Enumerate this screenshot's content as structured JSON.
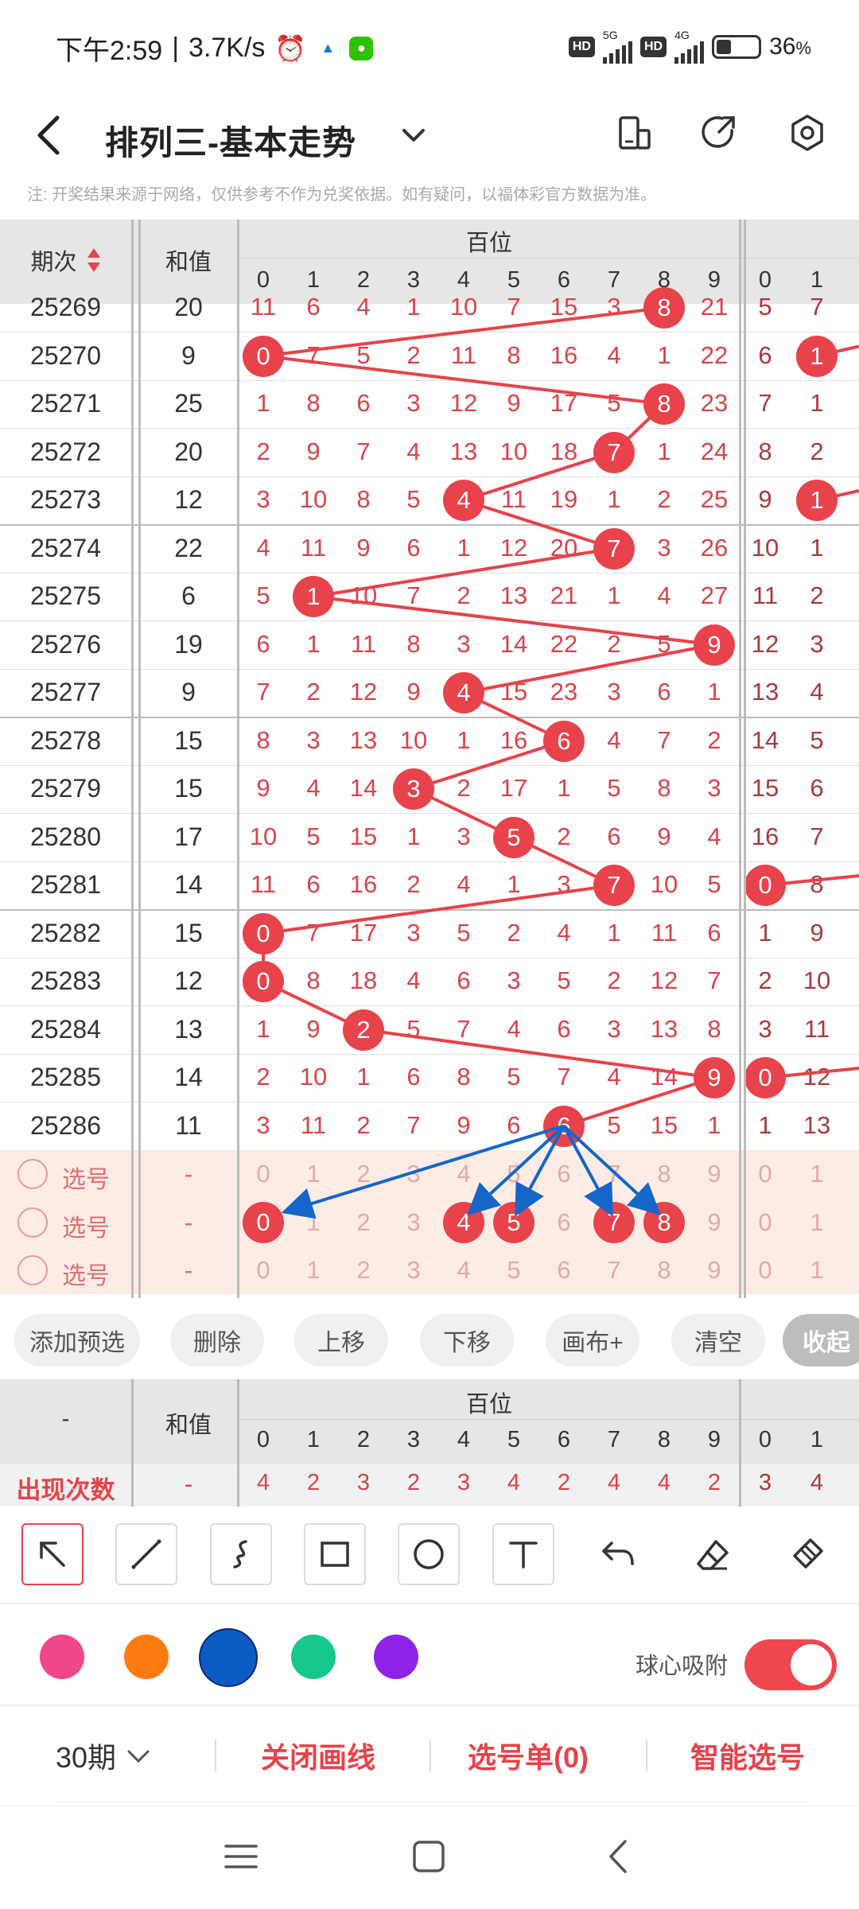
{
  "status_bar": {
    "time": "下午2:59",
    "speed": "3.7K/s",
    "hd1": "HD",
    "net1": "5G",
    "hd2": "HD",
    "net2": "4G",
    "battery": "36",
    "battery_unit": "%",
    "battery_level": 0.36
  },
  "header": {
    "title": "排列三-基本走势"
  },
  "note": "注: 开奖结果来源于网络，仅供参考不作为兑奖依据。如有疑问，以福体彩官方数据为准。",
  "table": {
    "col_issue": "期次",
    "col_sum": "和值",
    "group_hundreds": "百位",
    "digits": [
      "0",
      "1",
      "2",
      "3",
      "4",
      "5",
      "6",
      "7",
      "8",
      "9"
    ],
    "digits_next": [
      "0",
      "1"
    ],
    "rows": [
      {
        "issue": "25269",
        "sum": "20",
        "cells": [
          "11",
          "6",
          "4",
          "1",
          "10",
          "7",
          "15",
          "3",
          "8",
          "21"
        ],
        "next": [
          "5",
          "7"
        ],
        "hit": 8
      },
      {
        "issue": "25270",
        "sum": "9",
        "cells": [
          "0",
          "7",
          "5",
          "2",
          "11",
          "8",
          "16",
          "4",
          "1",
          "22"
        ],
        "next": [
          "6",
          "1"
        ],
        "hit": 0,
        "next_hit": 1
      },
      {
        "issue": "25271",
        "sum": "25",
        "cells": [
          "1",
          "8",
          "6",
          "3",
          "12",
          "9",
          "17",
          "5",
          "8",
          "23"
        ],
        "next": [
          "7",
          "1"
        ],
        "hit": 8
      },
      {
        "issue": "25272",
        "sum": "20",
        "cells": [
          "2",
          "9",
          "7",
          "4",
          "13",
          "10",
          "18",
          "7",
          "1",
          "24"
        ],
        "next": [
          "8",
          "2"
        ],
        "hit": 7
      },
      {
        "issue": "25273",
        "sum": "12",
        "cells": [
          "3",
          "10",
          "8",
          "5",
          "4",
          "11",
          "19",
          "1",
          "2",
          "25"
        ],
        "next": [
          "9",
          "1"
        ],
        "hit": 4,
        "next_hit": 1
      },
      {
        "issue": "25274",
        "sum": "22",
        "cells": [
          "4",
          "11",
          "9",
          "6",
          "1",
          "12",
          "20",
          "7",
          "3",
          "26"
        ],
        "next": [
          "10",
          "1"
        ],
        "hit": 7
      },
      {
        "issue": "25275",
        "sum": "6",
        "cells": [
          "5",
          "1",
          "10",
          "7",
          "2",
          "13",
          "21",
          "1",
          "4",
          "27"
        ],
        "next": [
          "11",
          "2"
        ],
        "hit": 1
      },
      {
        "issue": "25276",
        "sum": "19",
        "cells": [
          "6",
          "1",
          "11",
          "8",
          "3",
          "14",
          "22",
          "2",
          "5",
          "9"
        ],
        "next": [
          "12",
          "3"
        ],
        "hit": 9
      },
      {
        "issue": "25277",
        "sum": "9",
        "cells": [
          "7",
          "2",
          "12",
          "9",
          "4",
          "15",
          "23",
          "3",
          "6",
          "1"
        ],
        "next": [
          "13",
          "4"
        ],
        "hit": 4
      },
      {
        "issue": "25278",
        "sum": "15",
        "cells": [
          "8",
          "3",
          "13",
          "10",
          "1",
          "16",
          "6",
          "4",
          "7",
          "2"
        ],
        "next": [
          "14",
          "5"
        ],
        "hit": 6
      },
      {
        "issue": "25279",
        "sum": "15",
        "cells": [
          "9",
          "4",
          "14",
          "3",
          "2",
          "17",
          "1",
          "5",
          "8",
          "3"
        ],
        "next": [
          "15",
          "6"
        ],
        "hit": 3
      },
      {
        "issue": "25280",
        "sum": "17",
        "cells": [
          "10",
          "5",
          "15",
          "1",
          "3",
          "5",
          "2",
          "6",
          "9",
          "4"
        ],
        "next": [
          "16",
          "7"
        ],
        "hit": 5
      },
      {
        "issue": "25281",
        "sum": "14",
        "cells": [
          "11",
          "6",
          "16",
          "2",
          "4",
          "1",
          "3",
          "7",
          "10",
          "5"
        ],
        "next": [
          "0",
          "8"
        ],
        "hit": 7,
        "next_hit": 0
      },
      {
        "issue": "25282",
        "sum": "15",
        "cells": [
          "0",
          "7",
          "17",
          "3",
          "5",
          "2",
          "4",
          "1",
          "11",
          "6"
        ],
        "next": [
          "1",
          "9"
        ],
        "hit": 0
      },
      {
        "issue": "25283",
        "sum": "12",
        "cells": [
          "0",
          "8",
          "18",
          "4",
          "6",
          "3",
          "5",
          "2",
          "12",
          "7"
        ],
        "next": [
          "2",
          "10"
        ],
        "hit": 0
      },
      {
        "issue": "25284",
        "sum": "13",
        "cells": [
          "1",
          "9",
          "2",
          "5",
          "7",
          "4",
          "6",
          "3",
          "13",
          "8"
        ],
        "next": [
          "3",
          "11"
        ],
        "hit": 2
      },
      {
        "issue": "25285",
        "sum": "14",
        "cells": [
          "2",
          "10",
          "1",
          "6",
          "8",
          "5",
          "7",
          "4",
          "14",
          "9"
        ],
        "next": [
          "0",
          "12"
        ],
        "hit": 9,
        "next_hit": 0
      },
      {
        "issue": "25286",
        "sum": "11",
        "cells": [
          "3",
          "11",
          "2",
          "7",
          "9",
          "6",
          "6",
          "5",
          "15",
          "1"
        ],
        "next": [
          "1",
          "13"
        ],
        "hit": 6
      }
    ],
    "pick_label": "选号",
    "pick_sum": "-",
    "pick_digits": [
      "0",
      "1",
      "2",
      "3",
      "4",
      "5",
      "6",
      "7",
      "8",
      "9"
    ],
    "pick_next": [
      "0",
      "1"
    ],
    "pick_selected": [
      0,
      4,
      5,
      7,
      8
    ]
  },
  "actions": {
    "add": "添加预选",
    "delete": "删除",
    "up": "上移",
    "down": "下移",
    "canvas": "画布+",
    "clear": "清空",
    "collapse": "收起"
  },
  "stats": {
    "dash": "-",
    "col_sum": "和值",
    "group": "百位",
    "digits": [
      "0",
      "1",
      "2",
      "3",
      "4",
      "5",
      "6",
      "7",
      "8",
      "9"
    ],
    "digits_next": [
      "0",
      "1"
    ],
    "row_label": "出现次数",
    "row_sum": "-",
    "counts": [
      "4",
      "2",
      "3",
      "2",
      "3",
      "4",
      "2",
      "4",
      "4",
      "2"
    ],
    "counts_next": [
      "3",
      "4"
    ]
  },
  "toolbar": {
    "tools": [
      "arrow-tool-icon",
      "line-tool-icon",
      "curve-tool-icon",
      "rect-tool-icon",
      "circle-tool-icon",
      "text-tool-icon",
      "undo-icon",
      "eraser-icon",
      "clear-brush-icon"
    ]
  },
  "colors": {
    "swatches": [
      "#f0468a",
      "#ff7a0f",
      "#0a5bc4",
      "#14c98a",
      "#8f22e8"
    ],
    "selected": "#0a5bc4",
    "snap_label": "球心吸附"
  },
  "bottom": {
    "period": "30期",
    "close_draw": "关闭画线",
    "pick_list": "选号单(0)",
    "smart_pick": "智能选号"
  }
}
